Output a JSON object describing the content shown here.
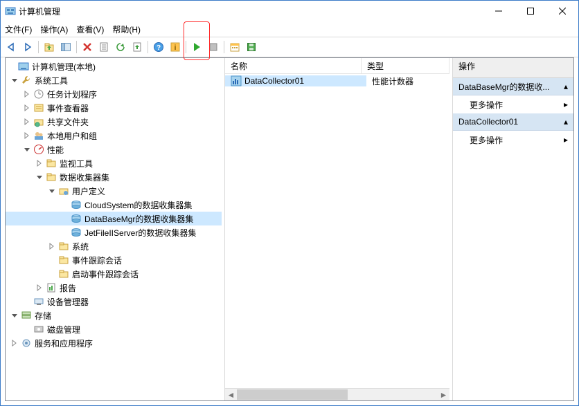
{
  "window": {
    "title": "计算机管理"
  },
  "menu": {
    "file": "文件(F)",
    "action": "操作(A)",
    "view": "查看(V)",
    "help": "帮助(H)"
  },
  "tree": {
    "root": "计算机管理(本地)",
    "sys_tools": "系统工具",
    "task_sched": "任务计划程序",
    "event_viewer": "事件查看器",
    "shared": "共享文件夹",
    "users": "本地用户和组",
    "perf": "性能",
    "mon_tools": "监视工具",
    "dcs": "数据收集器集",
    "user_def": "用户定义",
    "cloud": "CloudSystem的数据收集器集",
    "dbmgr": "DataBaseMgr的数据收集器集",
    "jetfile": "JetFileIIServer的数据收集器集",
    "system_dcs": "系统",
    "event_sess": "事件跟踪会话",
    "startup_sess": "启动事件跟踪会话",
    "reports": "报告",
    "devmgr": "设备管理器",
    "storage": "存储",
    "diskmgr": "磁盘管理",
    "services": "服务和应用程序"
  },
  "list": {
    "col_name": "名称",
    "col_type": "类型",
    "row0_name": "DataCollector01",
    "row0_type": "性能计数器"
  },
  "actions": {
    "title": "操作",
    "group1": "DataBaseMgr的数据收...",
    "more": "更多操作",
    "group2": "DataCollector01"
  }
}
